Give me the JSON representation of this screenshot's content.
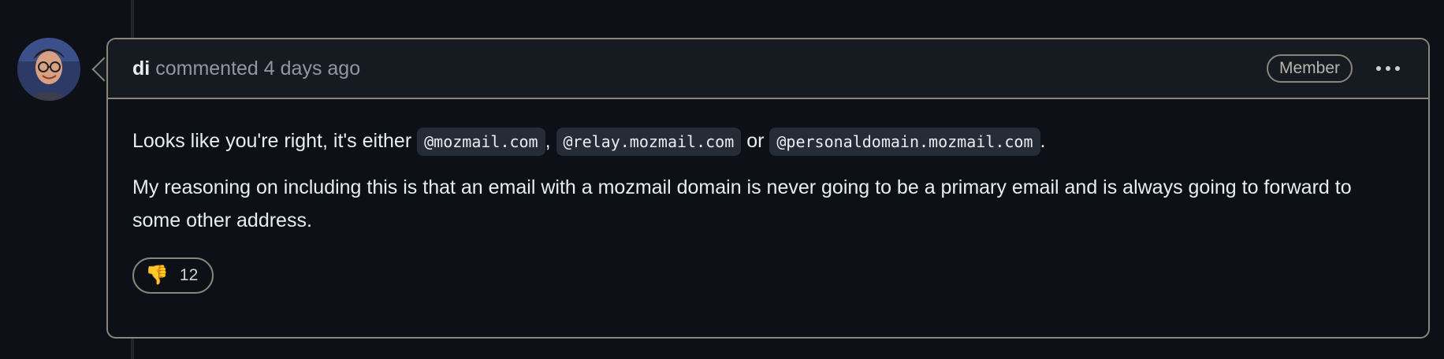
{
  "comment": {
    "author": "di",
    "action": "commented",
    "timestamp": "4 days ago",
    "role_badge": "Member",
    "menu_icon": "kebab-horizontal-icon",
    "body": {
      "p1_lead": "Looks like you're right, it's either ",
      "code1": "@mozmail.com",
      "sep1": ", ",
      "code2": "@relay.mozmail.com",
      "sep2": " or ",
      "code3": "@personaldomain.mozmail.com",
      "p1_end": ".",
      "p2": "My reasoning on including this is that an email with a mozmail domain is never going to be a primary email and is always going to forward to some other address."
    },
    "reactions": [
      {
        "icon": "thumbs-down-icon",
        "emoji": "👎",
        "count": "12"
      }
    ]
  },
  "colors": {
    "background": "#0d1117",
    "header_bg": "#161b22",
    "border": "#8b8579",
    "muted_text": "#9198a1"
  }
}
